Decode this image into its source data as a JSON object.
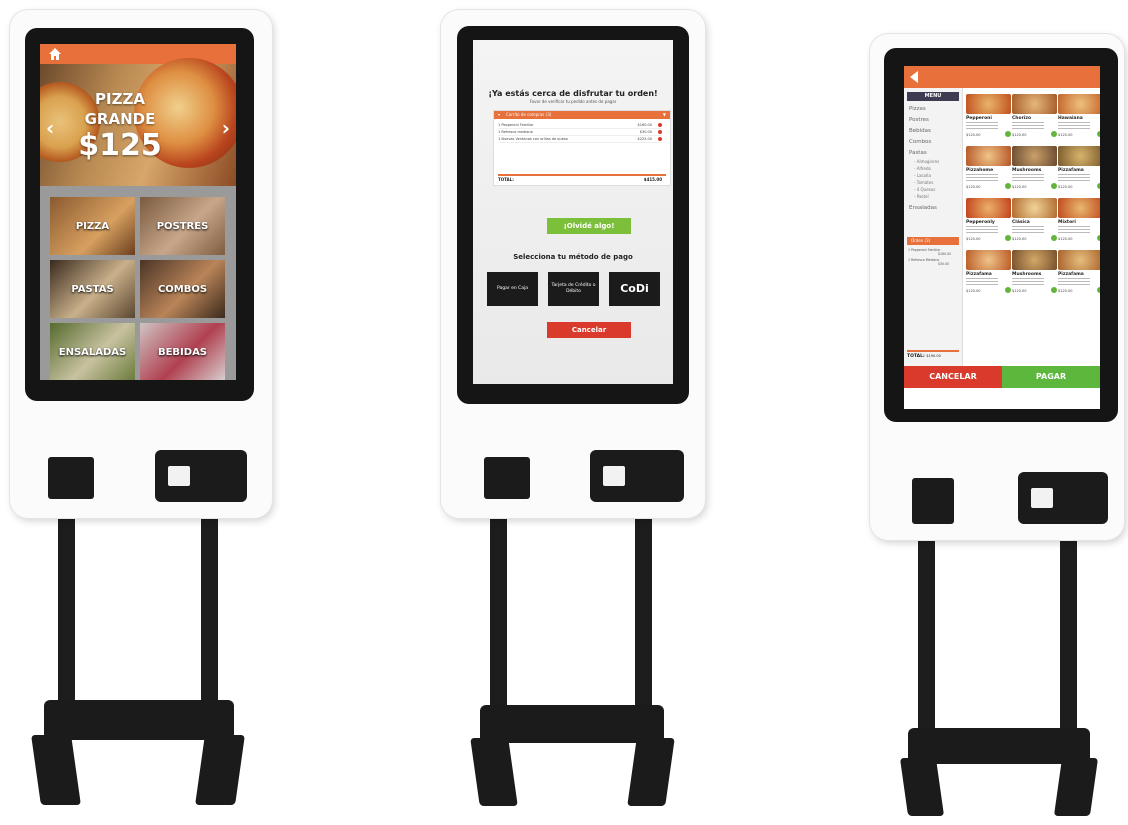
{
  "kiosk_left": {
    "home_icon": "home-icon",
    "banner": {
      "line1": "PIZZA",
      "line2": "GRANDE",
      "price": "$125",
      "prev": "‹",
      "next": "›"
    },
    "categories": [
      "PIZZA",
      "POSTRES",
      "PASTAS",
      "COMBOS",
      "ENSALADAS",
      "BEBIDAS"
    ]
  },
  "kiosk_center": {
    "heading": "¡Ya estás cerca de disfrutar tu orden!",
    "subheading": "Favor de verificar tu pedido antes de pagar",
    "cart_title": "Carrito de compras (3)",
    "cart_items": [
      {
        "name": "1 Pepperoni Familiar",
        "price": "$160.00"
      },
      {
        "name": "1 Refresco mediano",
        "price": "$30.00"
      },
      {
        "name": "1 Nuevas Ventanas con orillas de queso",
        "price": "$225.00"
      }
    ],
    "total_label": "TOTAL:",
    "total_value": "$415.00",
    "forgot_button": "¡Olvidé algo!",
    "payment_title": "Selecciona tu método de pago",
    "pay_cash": "Pagar en Caja",
    "pay_card": "Tarjeta de Crédito o Débito",
    "pay_codi": "CoDi",
    "cancel_button": "Cancelar"
  },
  "kiosk_right": {
    "back_icon": "back-arrow-icon",
    "menu_title": "MENU",
    "menu_items": [
      "Pizzas",
      "Postres",
      "Bebidas",
      "Combos",
      "Pastas"
    ],
    "pasta_subitems": [
      "- Almoginres",
      "- Alfredo",
      "- Lasaña",
      "- Tomates",
      "- 4 Quesos",
      "- Pastel"
    ],
    "menu_after": "Ensaladas",
    "order_title": "Orden (3)",
    "order_lines": [
      "1 Pepperoni Familiar",
      "$160.00",
      "1 Refresco Mediano",
      "$30.00"
    ],
    "total_label": "TOTAL:",
    "total_value": "$190.00",
    "products": [
      {
        "name": "Pepperoni",
        "price": "$120.00"
      },
      {
        "name": "Chorizo",
        "price": "$120.00"
      },
      {
        "name": "Hawaiana",
        "price": "$120.00"
      },
      {
        "name": "Pizzahome",
        "price": "$120.00"
      },
      {
        "name": "Mushrooms",
        "price": "$120.00"
      },
      {
        "name": "Pizzafama",
        "price": "$120.00"
      },
      {
        "name": "Pepperonly",
        "price": "$120.00"
      },
      {
        "name": "Clásica",
        "price": "$120.00"
      },
      {
        "name": "Mixtori",
        "price": "$120.00"
      },
      {
        "name": "Pizzafama",
        "price": "$120.00"
      },
      {
        "name": "Mushrooms",
        "price": "$120.00"
      },
      {
        "name": "Pizzafama",
        "price": "$120.00"
      }
    ],
    "cancel_button": "CANCELAR",
    "pay_button": "PAGAR"
  }
}
